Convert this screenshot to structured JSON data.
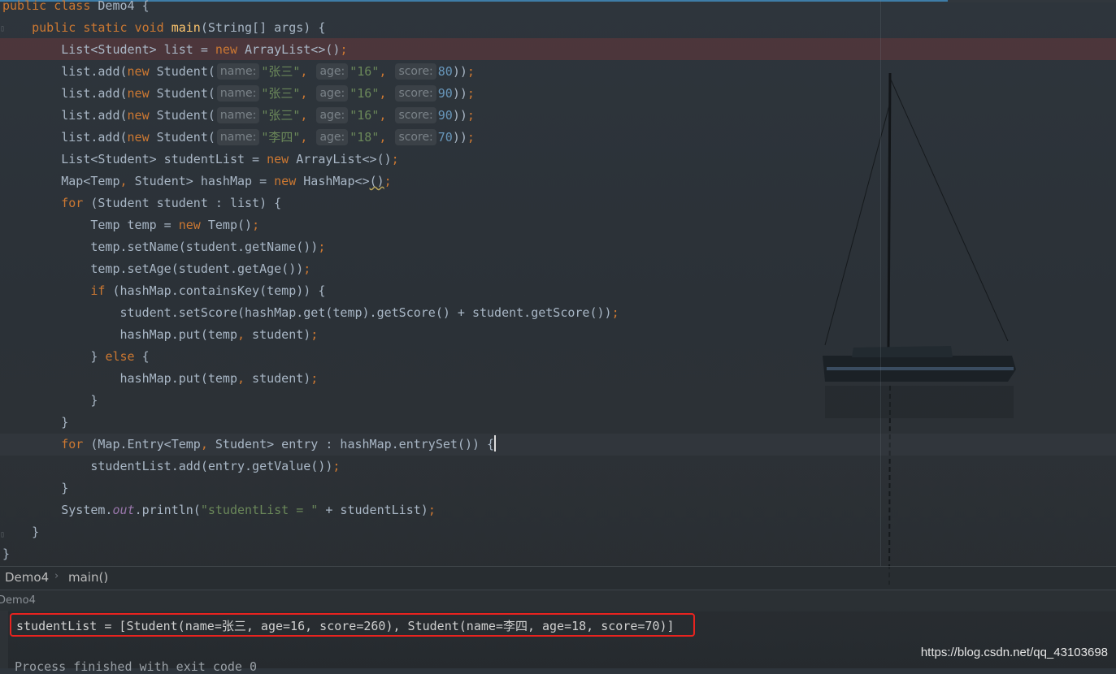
{
  "editor": {
    "lines": [
      "public class Demo4 {",
      "public static void main(String[] args) {",
      "List<Student> list = new ArrayList<>();",
      "list.add(new Student(name:\"张三\", age:\"16\", score:80));",
      "list.add(new Student(name:\"张三\", age:\"16\", score:90));",
      "list.add(new Student(name:\"张三\", age:\"16\", score:90));",
      "list.add(new Student(name:\"李四\", age:\"18\", score:70));",
      "List<Student> studentList = new ArrayList<>();",
      "Map<Temp, Student> hashMap = new HashMap<>();",
      "for (Student student : list) {",
      "Temp temp = new Temp();",
      "temp.setName(student.getName());",
      "temp.setAge(student.getAge());",
      "if (hashMap.containsKey(temp)) {",
      "student.setScore(hashMap.get(temp).getScore() + student.getScore());",
      "hashMap.put(temp, student);",
      "} else {",
      "hashMap.put(temp, student);",
      "}",
      "}",
      "for (Map.Entry<Temp, Student> entry : hashMap.entrySet()) {",
      "studentList.add(entry.getValue());",
      "}",
      "System.out.println(\"studentList = \" + studentList);",
      "}",
      "}"
    ]
  },
  "breadcrumb": {
    "class": "Demo4",
    "method": "main()"
  },
  "run_panel": {
    "tab_label": "Demo4"
  },
  "console": {
    "output": "studentList = [Student(name=张三, age=16, score=260), Student(name=李四, age=18, score=70)]",
    "cutoff_line": "Process finished with exit code 0"
  },
  "watermark": "https://blog.csdn.net/qq_43103698",
  "colors": {
    "keyword": "#cc7832",
    "method": "#ffc66d",
    "string": "#6a8759",
    "number": "#6897bb",
    "highlight_box": "#e8231f"
  }
}
